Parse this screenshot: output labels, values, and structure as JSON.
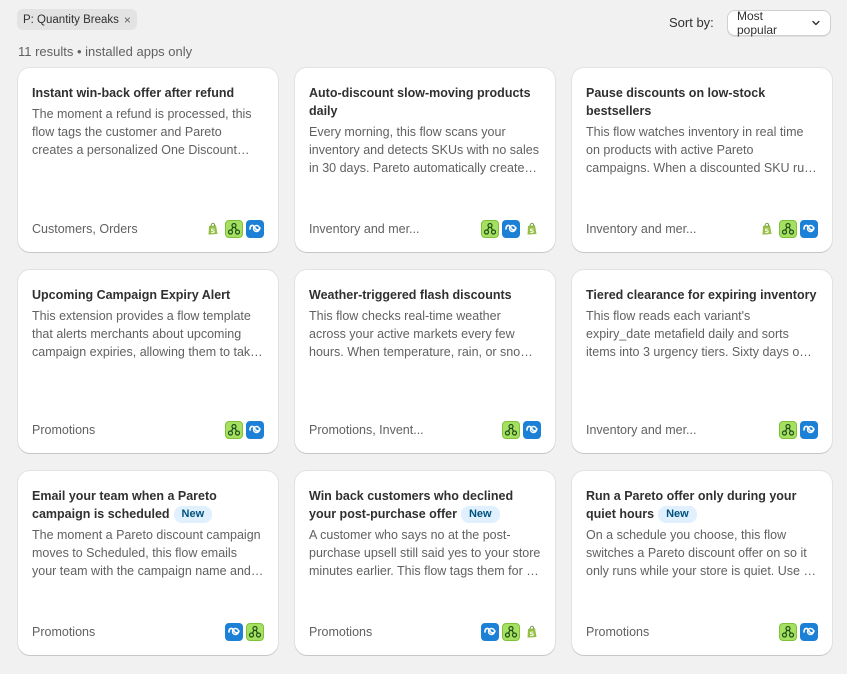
{
  "filter": {
    "label": "P: Quantity Breaks",
    "remove": "×"
  },
  "sort": {
    "label": "Sort by:",
    "value": "Most popular"
  },
  "results": "11 results • installed apps only",
  "cards": [
    {
      "title": "Instant win-back offer after refund",
      "badge": "",
      "desc": "The moment a refund is processed, this flow tags the customer and Pareto creates a personalized One Discount offer for them automatically.",
      "category": "Customers, Orders",
      "icons": [
        "shopify-icon",
        "flow-icon",
        "pareto-icon"
      ]
    },
    {
      "title": "Auto-discount slow-moving products daily",
      "badge": "",
      "desc": "Every morning, this flow scans your inventory and detects SKUs with no sales in 30 days. Pareto automatically creates discounts for them.",
      "category": "Inventory and mer...",
      "icons": [
        "flow-icon",
        "pareto-icon",
        "shopify-icon"
      ]
    },
    {
      "title": "Pause discounts on low-stock bestsellers",
      "badge": "",
      "desc": "This flow watches inventory in real time on products with active Pareto campaigns. When a discounted SKU runs low, the campaign is paused.",
      "category": "Inventory and mer...",
      "icons": [
        "shopify-icon",
        "flow-icon",
        "pareto-icon"
      ]
    },
    {
      "title": "Upcoming Campaign Expiry Alert",
      "badge": "",
      "desc": "This extension provides a flow template that alerts merchants about upcoming campaign expiries, allowing them to take action in time.",
      "category": "Promotions",
      "icons": [
        "flow-icon",
        "pareto-icon"
      ]
    },
    {
      "title": "Weather-triggered flash discounts",
      "badge": "",
      "desc": "This flow checks real-time weather across your active markets every few hours. When temperature, rain, or snow changes, discounts start.",
      "category": "Promotions, Invent...",
      "icons": [
        "flow-icon",
        "pareto-icon"
      ]
    },
    {
      "title": "Tiered clearance for expiring inventory",
      "badge": "",
      "desc": "This flow reads each variant's expiry_date metafield daily and sorts items into 3 urgency tiers. Sixty days out gets a small discount.",
      "category": "Inventory and mer...",
      "icons": [
        "flow-icon",
        "pareto-icon"
      ]
    },
    {
      "title": "Email your team when a Pareto campaign is scheduled",
      "badge": "New",
      "desc": "The moment a Pareto discount campaign moves to Scheduled, this flow emails your team with the campaign name and start date.",
      "category": "Promotions",
      "icons": [
        "pareto-icon",
        "flow-icon"
      ]
    },
    {
      "title": "Win back customers who declined your post-purchase offer",
      "badge": "New",
      "desc": "A customer who says no at the post-purchase upsell still said yes to your store minutes earlier. This flow tags them for a follow-up.",
      "category": "Promotions",
      "icons": [
        "pareto-icon",
        "flow-icon",
        "shopify-icon"
      ]
    },
    {
      "title": "Run a Pareto offer only during your quiet hours",
      "badge": "New",
      "desc": "On a schedule you choose, this flow switches a Pareto discount offer on so it only runs while your store is quiet. Use it overnight.",
      "category": "Promotions",
      "icons": [
        "flow-icon",
        "pareto-icon"
      ]
    }
  ]
}
